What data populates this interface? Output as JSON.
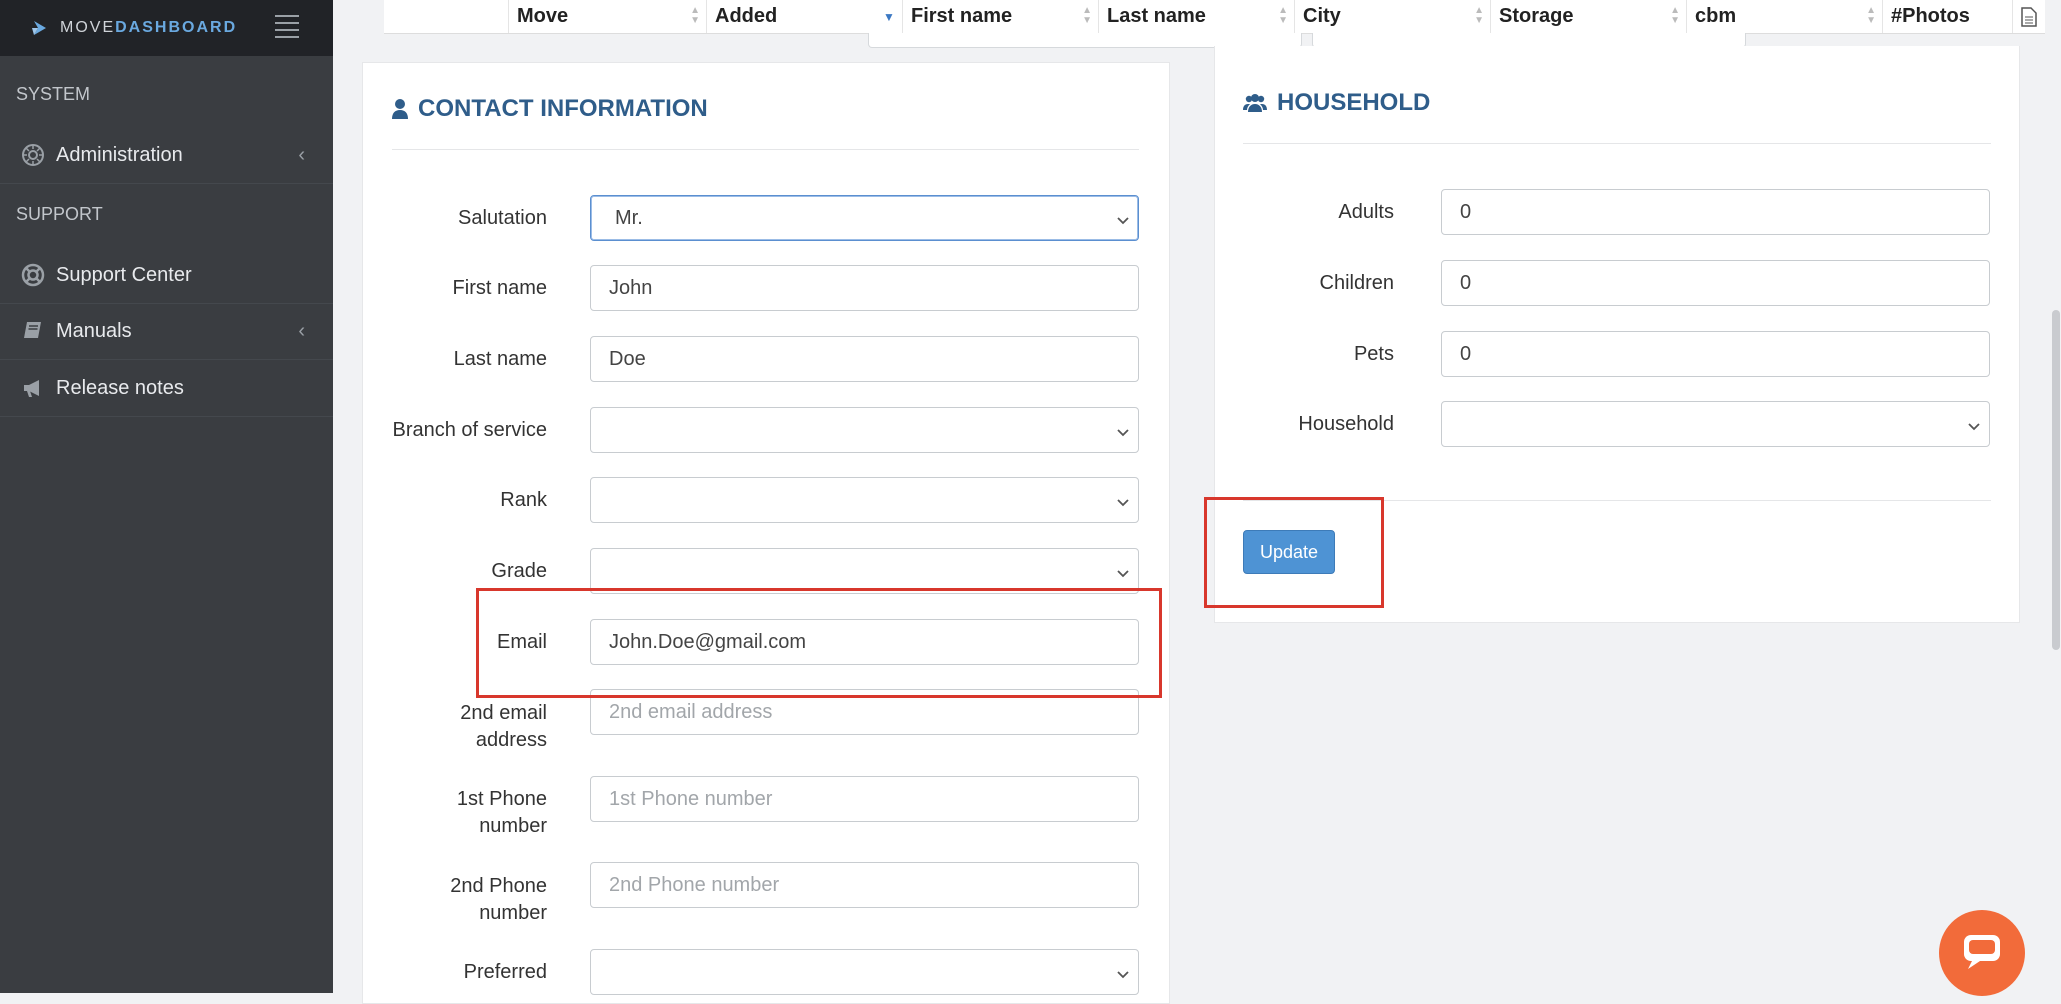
{
  "brand": {
    "pre": "MOVE",
    "name": "DASHBOARD"
  },
  "sidebar": {
    "sections": [
      {
        "label": "SYSTEM"
      },
      {
        "label": "SUPPORT"
      }
    ],
    "items": [
      {
        "label": "Administration",
        "icon": "gear-icon",
        "has_chevron": true
      },
      {
        "label": "Support Center",
        "icon": "lifebuoy-icon",
        "has_chevron": false
      },
      {
        "label": "Manuals",
        "icon": "book-icon",
        "has_chevron": true
      },
      {
        "label": "Release notes",
        "icon": "megaphone-icon",
        "has_chevron": false
      }
    ]
  },
  "table_header": {
    "columns": [
      "Move",
      "Added",
      "First name",
      "Last name",
      "City",
      "Storage",
      "cbm",
      "#Photos"
    ]
  },
  "contact": {
    "title": "CONTACT INFORMATION",
    "fields": {
      "salutation": {
        "label": "Salutation",
        "value": "Mr."
      },
      "first_name": {
        "label": "First name",
        "value": "John"
      },
      "last_name": {
        "label": "Last name",
        "value": "Doe"
      },
      "branch": {
        "label": "Branch of service",
        "value": ""
      },
      "rank": {
        "label": "Rank",
        "value": ""
      },
      "grade": {
        "label": "Grade",
        "value": ""
      },
      "email": {
        "label": "Email",
        "value": "John.Doe@gmail.com"
      },
      "email2": {
        "label_1": "2nd email",
        "label_2": "address",
        "placeholder": "2nd email address"
      },
      "phone1": {
        "label_1": "1st Phone",
        "label_2": "number",
        "placeholder": "1st Phone number"
      },
      "phone2": {
        "label_1": "2nd Phone",
        "label_2": "number",
        "placeholder": "2nd Phone number"
      },
      "preferred": {
        "label": "Preferred",
        "value": ""
      }
    }
  },
  "household": {
    "title": "HOUSEHOLD",
    "fields": {
      "adults": {
        "label": "Adults",
        "value": "0"
      },
      "children": {
        "label": "Children",
        "value": "0"
      },
      "pets": {
        "label": "Pets",
        "value": "0"
      },
      "household": {
        "label": "Household",
        "value": ""
      }
    },
    "update_label": "Update"
  },
  "colors": {
    "accent": "#4e93d4",
    "title": "#2f5d8a",
    "highlight": "#d8372c",
    "sidebar": "#3a3d41",
    "chat": "#f26b3a"
  }
}
